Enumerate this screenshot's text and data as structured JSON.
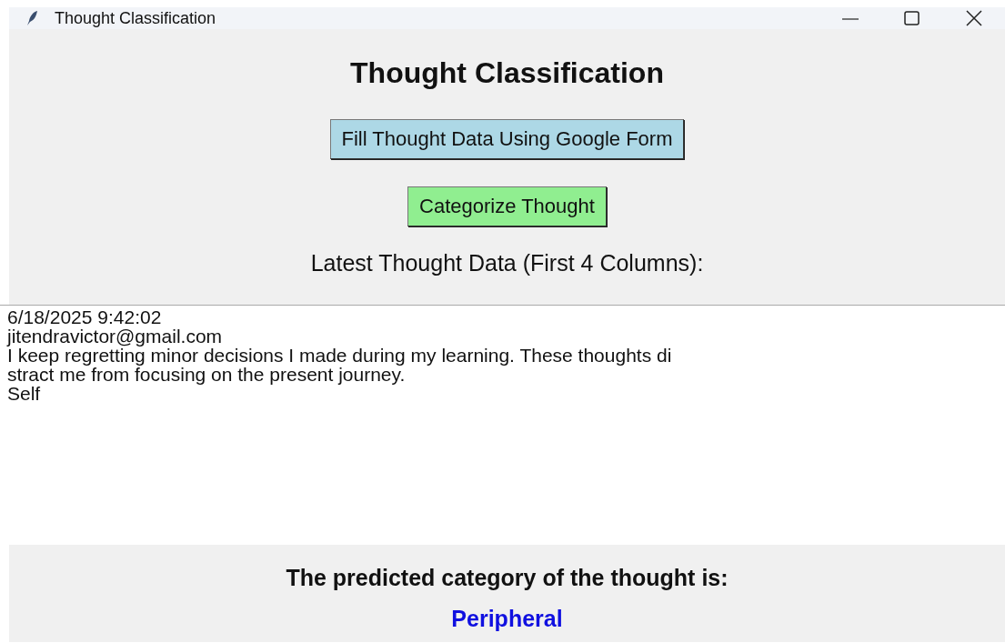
{
  "window": {
    "title": "Thought Classification"
  },
  "heading": "Thought Classification",
  "buttons": [
    {
      "label": "Fill Thought Data Using Google Form",
      "color": "#add8e6"
    },
    {
      "label": "Categorize Thought",
      "color": "#90ee90"
    }
  ],
  "data_label": "Latest Thought Data (First 4 Columns):",
  "data_lines": [
    "6/18/2025 9:42:02",
    "jitendravictor@gmail.com",
    "I keep regretting minor decisions I made during my learning. These thoughts di",
    "stract me from focusing on the present journey.",
    "Self"
  ],
  "result_label": "The predicted category of the thought is:",
  "result": "Peripheral"
}
